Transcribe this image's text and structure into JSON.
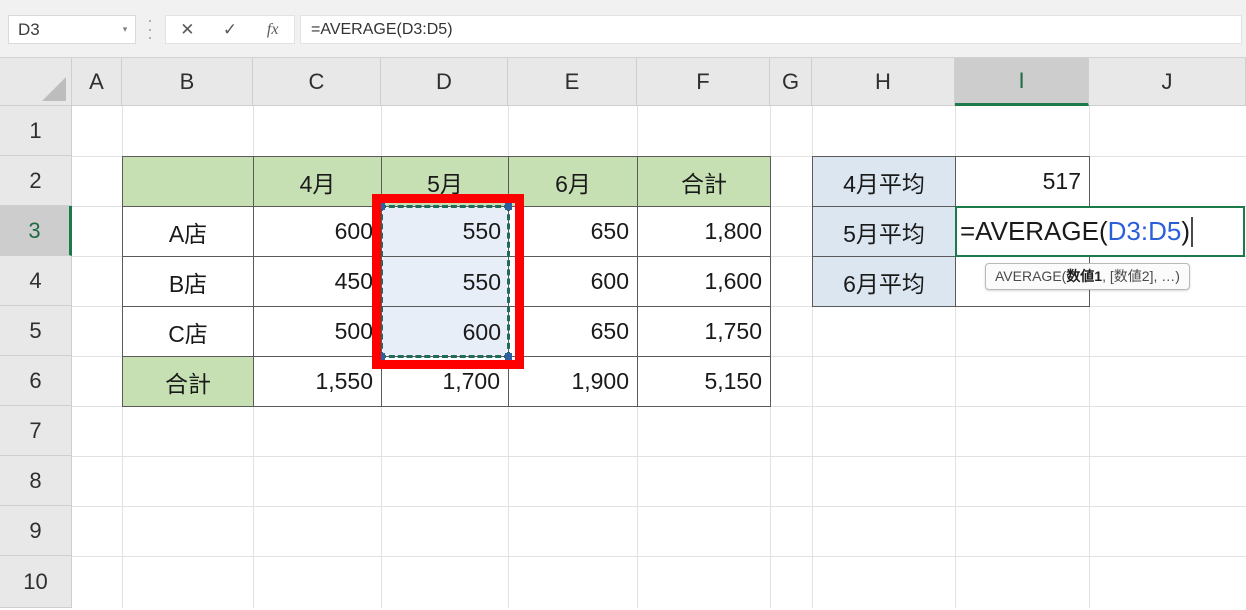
{
  "formula_bar": {
    "name_box_value": "D3",
    "name_box_arrow": "▾",
    "cancel_icon": "✕",
    "enter_icon": "✓",
    "fx_icon": "fx",
    "formula_value": "=AVERAGE(D3:D5)"
  },
  "columns": [
    {
      "label": "A",
      "active": false
    },
    {
      "label": "B",
      "active": false
    },
    {
      "label": "C",
      "active": false
    },
    {
      "label": "D",
      "active": false
    },
    {
      "label": "E",
      "active": false
    },
    {
      "label": "F",
      "active": false
    },
    {
      "label": "G",
      "active": false
    },
    {
      "label": "H",
      "active": false
    },
    {
      "label": "I",
      "active": true
    },
    {
      "label": "J",
      "active": false
    }
  ],
  "rows": [
    {
      "label": "1",
      "active": false
    },
    {
      "label": "2",
      "active": false
    },
    {
      "label": "3",
      "active": true
    },
    {
      "label": "4",
      "active": false
    },
    {
      "label": "5",
      "active": false
    },
    {
      "label": "6",
      "active": false
    },
    {
      "label": "7",
      "active": false
    },
    {
      "label": "8",
      "active": false
    },
    {
      "label": "9",
      "active": false
    },
    {
      "label": "10",
      "active": false
    }
  ],
  "sales_table": {
    "header": {
      "corner": "",
      "months": [
        "4月",
        "5月",
        "6月"
      ],
      "total": "合計"
    },
    "rows": [
      {
        "name": "A店",
        "values": [
          "600",
          "550",
          "650"
        ],
        "total": "1,800"
      },
      {
        "name": "B店",
        "values": [
          "450",
          "550",
          "600"
        ],
        "total": "1,600"
      },
      {
        "name": "C店",
        "values": [
          "500",
          "600",
          "650"
        ],
        "total": "1,750"
      }
    ],
    "footer": {
      "name": "合計",
      "values": [
        "1,550",
        "1,700",
        "1,900"
      ],
      "total": "5,150"
    }
  },
  "average_panel": {
    "labels": [
      "4月平均",
      "5月平均",
      "6月平均"
    ],
    "values": [
      "517",
      "",
      ""
    ]
  },
  "editing_cell": {
    "prefix": "=AVERAGE(",
    "reference": "D3:D5",
    "suffix": ")"
  },
  "tooltip": {
    "prefix": "AVERAGE(",
    "bold_arg": "数値1",
    "rest": ", [数値2], …)"
  },
  "colors": {
    "header_green": "#c6e0b4",
    "panel_blue": "#dce6f1",
    "selection_fill": "#e8eef8",
    "marching_ants": "#1f6b5c",
    "annotation_red": "#ff0000",
    "active_green": "#1c7a4a",
    "reference_blue": "#2b5fd9"
  }
}
